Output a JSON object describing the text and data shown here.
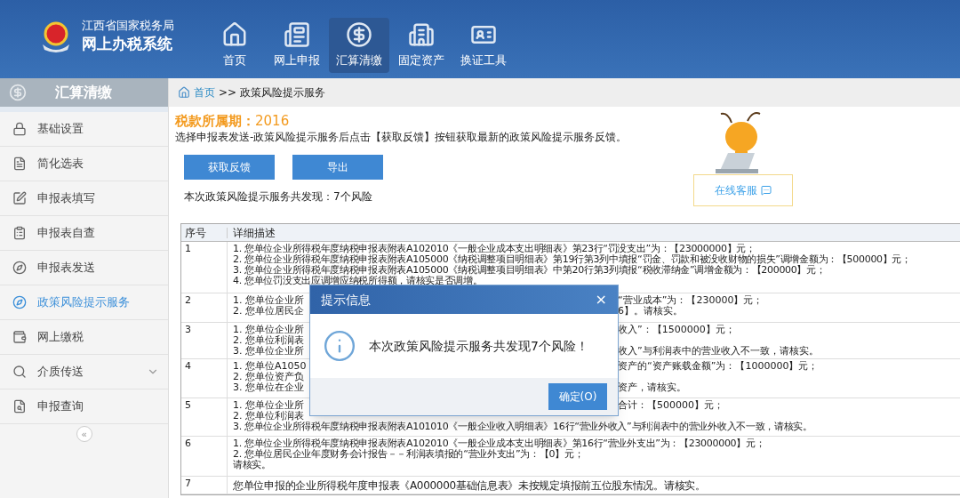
{
  "header": {
    "org": "江西省国家税务局",
    "system": "网上办税系统"
  },
  "nav": [
    {
      "label": "首页",
      "selected": false
    },
    {
      "label": "网上申报",
      "selected": false
    },
    {
      "label": "汇算清缴",
      "selected": true
    },
    {
      "label": "固定资产",
      "selected": false
    },
    {
      "label": "换证工具",
      "selected": false
    }
  ],
  "sidebar": {
    "title": "汇算清缴",
    "collapse": "«",
    "items": [
      {
        "label": "基础设置",
        "selected": false,
        "has_submenu": false
      },
      {
        "label": "简化选表",
        "selected": false,
        "has_submenu": false
      },
      {
        "label": "申报表填写",
        "selected": false,
        "has_submenu": false
      },
      {
        "label": "申报表自查",
        "selected": false,
        "has_submenu": false
      },
      {
        "label": "申报表发送",
        "selected": false,
        "has_submenu": false
      },
      {
        "label": "政策风险提示服务",
        "selected": true,
        "has_submenu": false
      },
      {
        "label": "网上缴税",
        "selected": false,
        "has_submenu": false
      },
      {
        "label": "介质传送",
        "selected": false,
        "has_submenu": true
      },
      {
        "label": "申报查询",
        "selected": false,
        "has_submenu": false
      }
    ]
  },
  "breadcrumb": {
    "home": "首页",
    "separator": ">>",
    "current": "政策风险提示服务"
  },
  "period": {
    "label": "税款所属期：",
    "value": "2016"
  },
  "instruction": "选择申报表发送-政策风险提示服务后点击【获取反馈】按钮获取最新的政策风险提示服务反馈。",
  "buttons": [
    "获取反馈",
    "导出"
  ],
  "service_button": "在线客服",
  "summary": "本次政策风险提示服务共发现：7个风险",
  "table": {
    "columns": [
      "序号",
      "详细描述"
    ],
    "rows": [
      {
        "index": "1",
        "lines": [
          {
            "text": "1. 您单位企业所得税年度纳税申报表附表A102010《一般企业成本支出明细表》第23行“罚没支出”为：【23000000】元；"
          },
          {
            "text": "2. 您单位企业所得税年度纳税申报表附表A105000《纳税调整项目明细表》第19行第3列中填报“罚金、罚款和被没收财物的损失”调增金额为：【500000】元；"
          },
          {
            "text": "3. 您单位企业所得税年度纳税申报表附表A105000《纳税调整项目明细表》中第20行第3列填报“税收滞纳金”调增金额为：【200000】元；"
          },
          {
            "text": "4. 您单位罚没支出应调增应纳税所得额，请核实是否调增。"
          }
        ]
      },
      {
        "index": "2",
        "lines": [
          {
            "left": "1. 您单位企业所",
            "right": "“营业成本”为：【230000】元；"
          },
          {
            "left": "2. 您单位居民企",
            "right": "6】。请核实。"
          }
        ]
      },
      {
        "index": "3",
        "lines": [
          {
            "left": "1. 您单位企业所",
            "right": "收入”：【1500000】元；"
          },
          {
            "left": "2. 您单位利润表"
          },
          {
            "left": "3. 您单位企业所",
            "right": "收入”与利润表中的营业收入不一致，请核实。"
          }
        ]
      },
      {
        "index": "4",
        "lines": [
          {
            "left": "1. 您单位A1050",
            "right": "资产的“资产账载金额”为：【1000000】元；"
          },
          {
            "left": "2. 您单位资产负"
          },
          {
            "left": "3. 您单位在企业",
            "right": "资产，请核实。"
          }
        ]
      },
      {
        "index": "5",
        "lines": [
          {
            "left": "1. 您单位企业所",
            "right": "合计：【500000】元；"
          },
          {
            "left": "2. 您单位利润表"
          },
          {
            "text": "3. 您单位企业所得税年度纳税申报表附表A101010《一般企业收入明细表》16行“营业外收入”与利润表中的营业外收入不一致，请核实。"
          }
        ]
      },
      {
        "index": "6",
        "lines": [
          {
            "text": "1. 您单位企业所得税年度纳税申报表附表A102010《一般企业成本支出明细表》第16行“营业外支出”为：【23000000】元；"
          },
          {
            "text": "2. 您单位居民企业年度财务会计报告－－利润表填报的“营业外支出”为：【0】元；"
          },
          {
            "text": "请核实。"
          }
        ]
      },
      {
        "index": "7",
        "lines": [
          {
            "text": "您单位申报的企业所得税年度申报表《A000000基础信息表》未按规定填报前五位股东情况。请核实。"
          }
        ]
      }
    ]
  },
  "dialog": {
    "title": "提示信息",
    "close": "×",
    "message": "本次政策风险提示服务共发现7个风险！",
    "ok": "确定(O)"
  }
}
